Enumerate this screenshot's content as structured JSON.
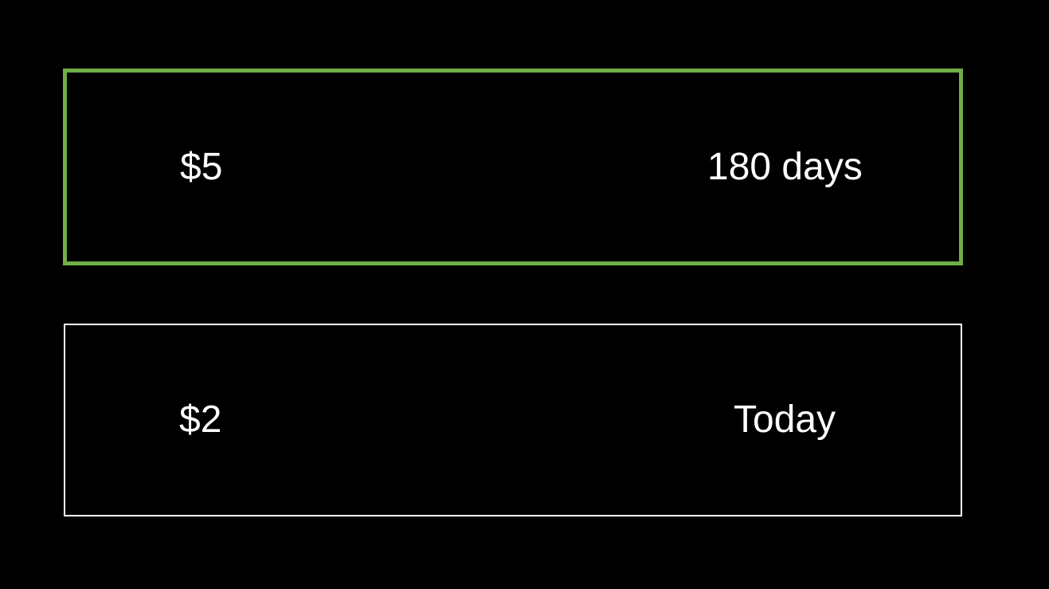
{
  "options": [
    {
      "amount": "$5",
      "timing": "180 days",
      "selected": true,
      "border_color": "#70ad47"
    },
    {
      "amount": "$2",
      "timing": "Today",
      "selected": false,
      "border_color": "#ffffff"
    }
  ],
  "colors": {
    "background": "#000000",
    "text": "#ffffff",
    "selected_border": "#70ad47",
    "default_border": "#ffffff"
  }
}
